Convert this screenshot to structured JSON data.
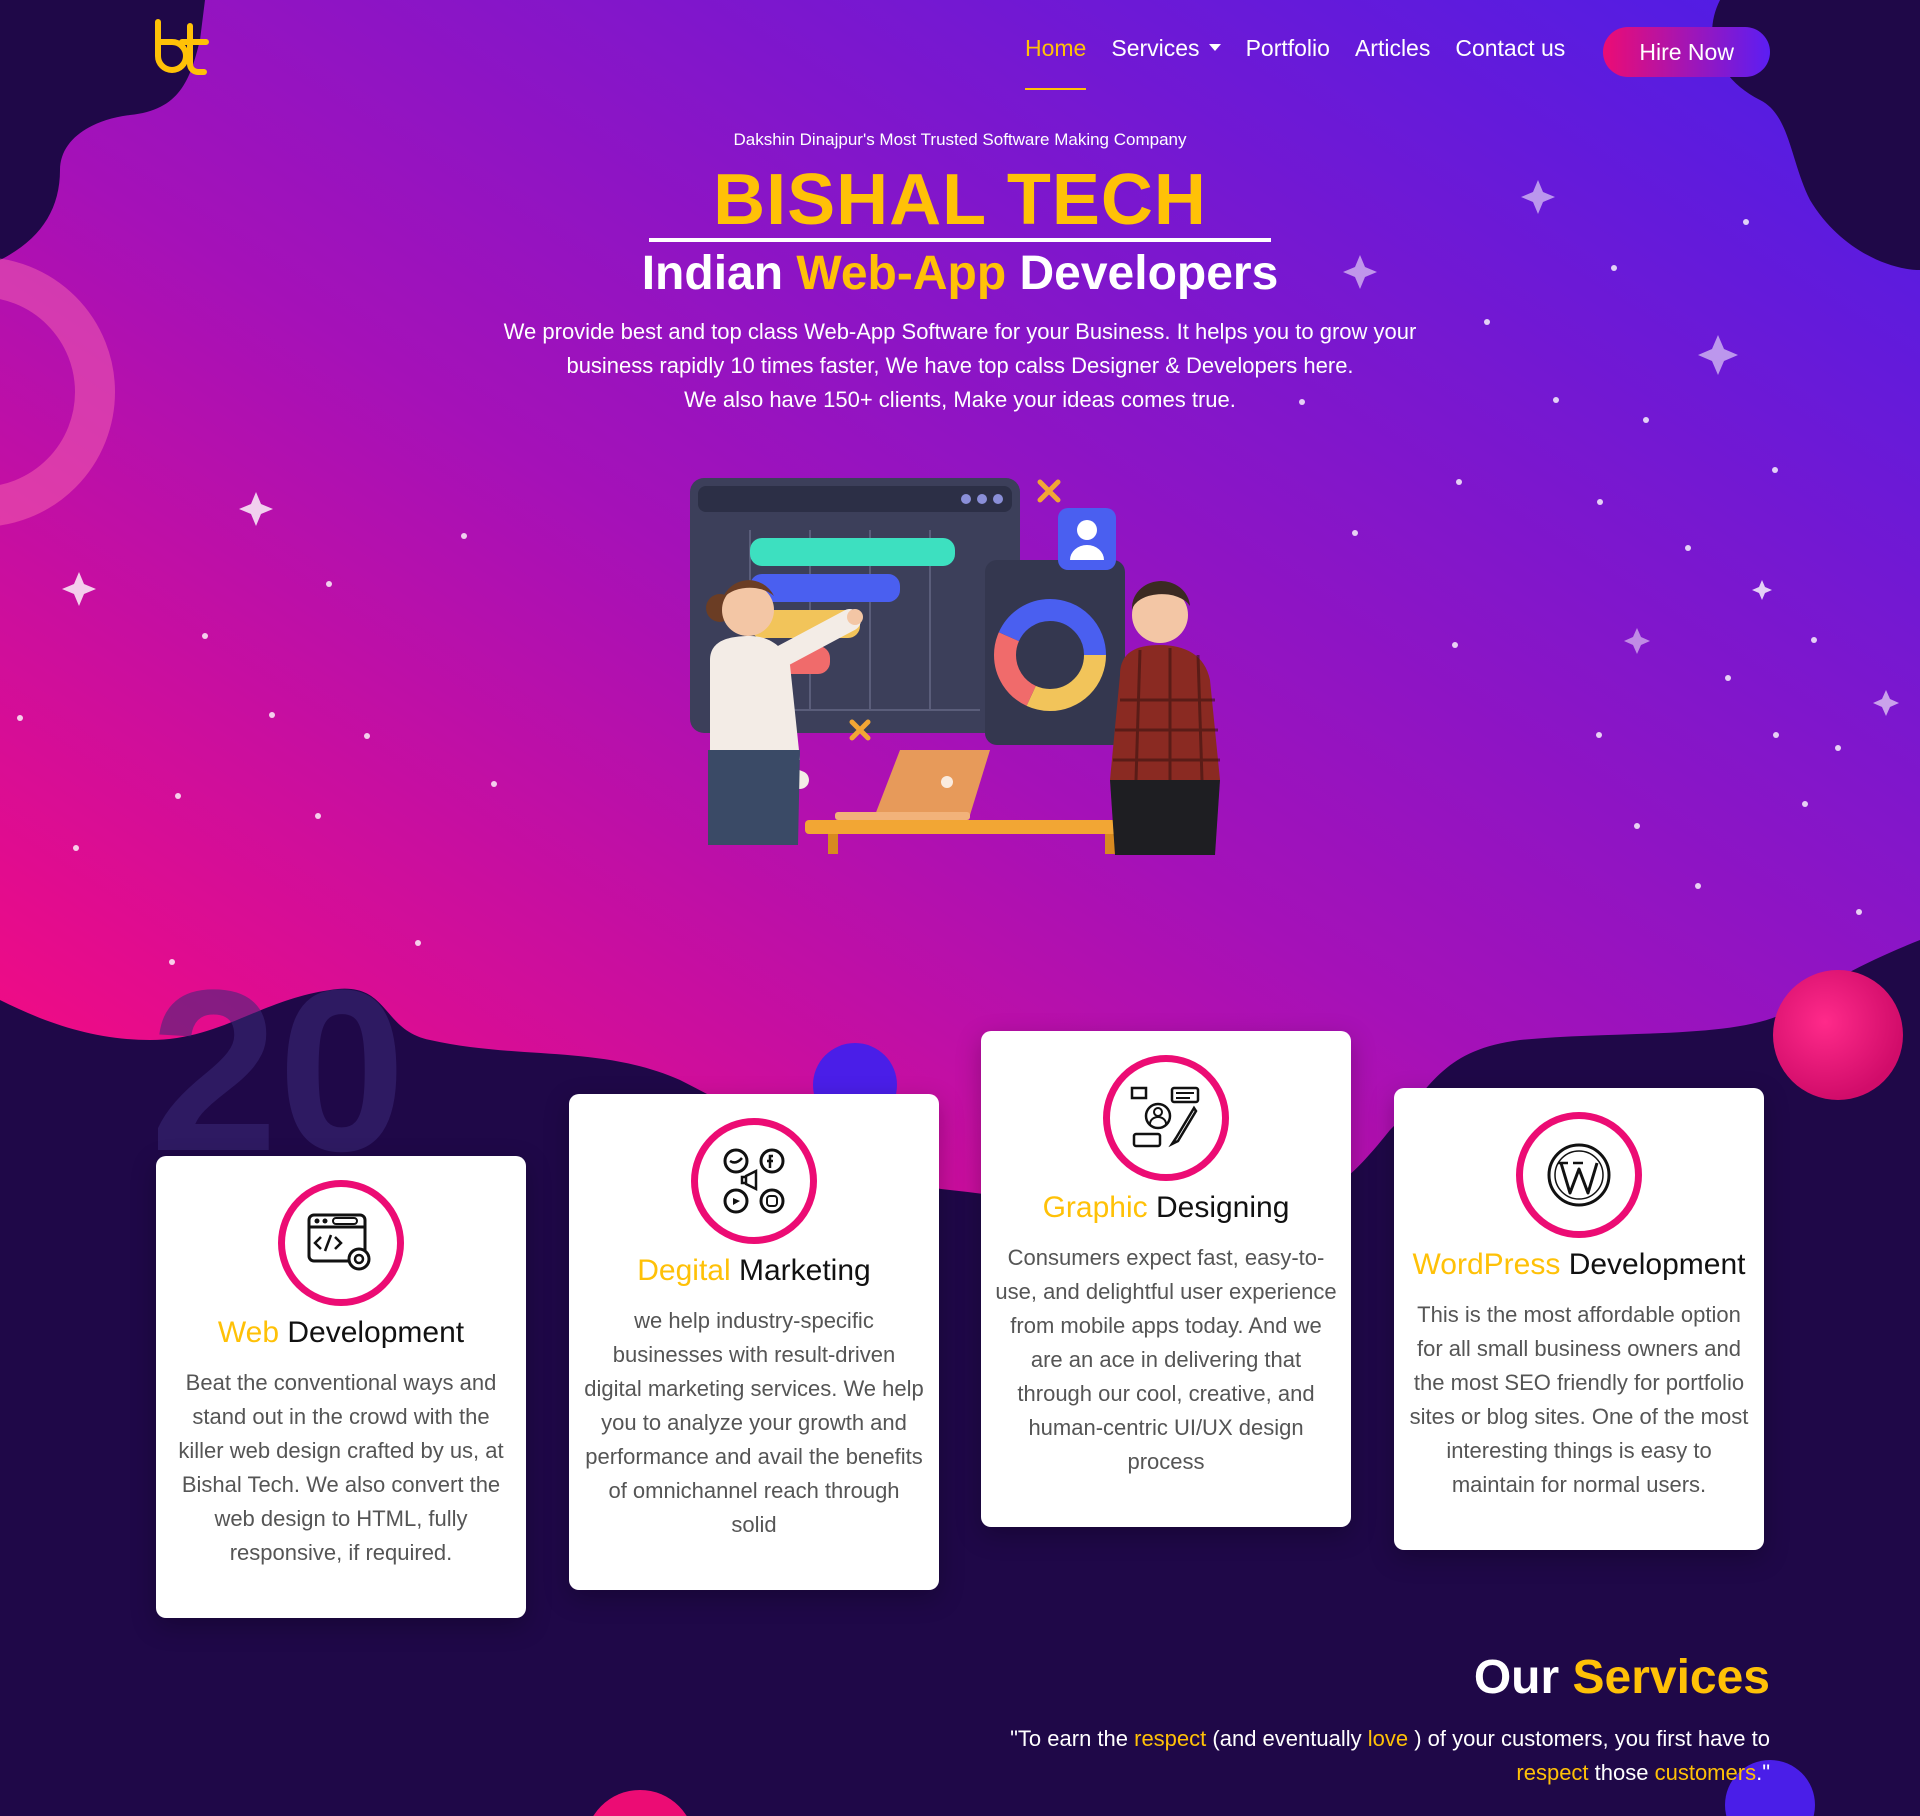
{
  "brand_logo": "bt",
  "nav": {
    "items": [
      {
        "label": "Home",
        "active": true
      },
      {
        "label": "Services",
        "dropdown": true
      },
      {
        "label": "Portfolio"
      },
      {
        "label": "Articles"
      },
      {
        "label": "Contact us"
      }
    ],
    "hire_button": "Hire Now"
  },
  "hero": {
    "tagline": "Dakshin Dinajpur's Most Trusted Software Making Company",
    "brand": "BISHAL TECH",
    "subtitle_pre": "Indian ",
    "subtitle_hl": "Web-App",
    "subtitle_post": " Developers",
    "line1": "We provide best and top class Web-App Software for your Business. It helps you to grow your",
    "line2": "business rapidly 10 times faster, We have top calss Designer & Developers here.",
    "line3": "We also have 150+ clients, Make your ideas comes true."
  },
  "colors": {
    "accent": "#ffc107",
    "pink": "#ec0c74",
    "purple": "#5b1ef3",
    "dark": "#1f0848"
  },
  "cards": [
    {
      "icon": "code-window-gear-icon",
      "title_hl": "Web",
      "title_rest": " Development",
      "text": "Beat the conventional ways and stand out in the crowd with the killer web design crafted by us, at Bishal Tech. We also convert the web design to HTML, fully responsive, if required."
    },
    {
      "icon": "social-media-icon",
      "title_hl": "Degital",
      "title_rest": " Marketing",
      "text": "we help industry-specific businesses with result-driven digital marketing services. We help you to analyze your growth and performance and avail the benefits of omnichannel reach through solid"
    },
    {
      "icon": "graphic-design-icon",
      "title_hl": "Graphic",
      "title_rest": " Designing",
      "text": "Consumers expect fast, easy-to-use, and delightful user experience from mobile apps today. And we are an ace in delivering that through our cool, creative, and human-centric UI/UX design process"
    },
    {
      "icon": "wordpress-icon",
      "title_hl": "WordPress",
      "title_rest": " Development",
      "text": "This is the most affordable option for all small business owners and the most SEO friendly for portfolio sites or blog sites. One of the most interesting things is easy to maintain for normal users."
    }
  ],
  "services": {
    "title_pre": "Our ",
    "title_hl": "Services",
    "quote_a": "\"To earn the ",
    "quote_b": "respect",
    "quote_c": " (and eventually ",
    "quote_d": "love",
    "quote_e": " ) of your customers, you first have to",
    "quote_f": "respect",
    "quote_g": " those ",
    "quote_h": "customers",
    "quote_i": ".\""
  },
  "watermark": "20"
}
